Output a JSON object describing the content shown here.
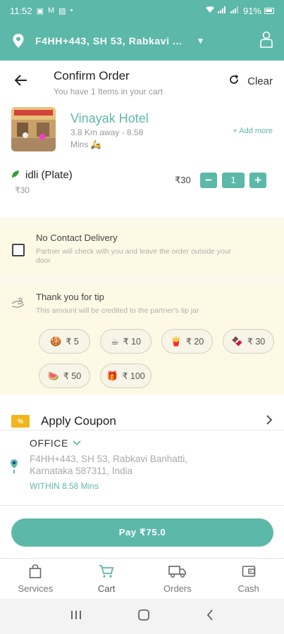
{
  "status_bar": {
    "time": "11:52",
    "battery": "91%"
  },
  "top_bar": {
    "location": "F4HH+443, SH 53, Rabkavi ..."
  },
  "header": {
    "title": "Confirm Order",
    "subtitle": "You have 1 Items in your cart",
    "clear_label": "Clear"
  },
  "restaurant": {
    "name": "Vinayak Hotel",
    "distance": "3.8 Km away - 8.58",
    "time": "Mins",
    "add_more_label": "+ Add more"
  },
  "cart_item": {
    "name": "idli (Plate)",
    "unit_price": "₹30",
    "price": "₹30",
    "quantity": "1",
    "minus_label": "−",
    "plus_label": "+"
  },
  "no_contact": {
    "title": "No Contact Delivery",
    "subtitle": "Partner will check with you and leave the order outside your door"
  },
  "tip": {
    "title": "Thank you for tip",
    "subtitle": "This amount will be credited to the partner's tip jar",
    "options": [
      {
        "icon": "cookie-icon",
        "glyph": "🍪",
        "label": "₹ 5"
      },
      {
        "icon": "coffee-icon",
        "glyph": "☕",
        "label": "₹ 10"
      },
      {
        "icon": "fries-icon",
        "glyph": "🍟",
        "label": "₹ 20"
      },
      {
        "icon": "chocolate-icon",
        "glyph": "🍫",
        "label": "₹ 30"
      },
      {
        "icon": "food-basket-icon",
        "glyph": "🍉",
        "label": "₹ 50"
      },
      {
        "icon": "gift-icon",
        "glyph": "🎁",
        "label": "₹ 100"
      }
    ]
  },
  "coupon": {
    "label": "Apply Coupon",
    "icon_text": "%"
  },
  "address": {
    "type": "OFFICE",
    "line1": "F4HH+443, SH 53, Rabkavi Banhatti,",
    "line2": "Karnataka 587311, India",
    "eta": "WITHIN 8.58 Mins"
  },
  "pay_button": {
    "label": "Pay ₹75.0"
  },
  "bottom_nav": {
    "items": [
      {
        "label": "Services"
      },
      {
        "label": "Cart"
      },
      {
        "label": "Orders"
      },
      {
        "label": "Cash"
      }
    ]
  },
  "colors": {
    "accent": "#5cb8a8",
    "tip_bg": "#fdf9e5",
    "coupon": "#f2b51d"
  }
}
